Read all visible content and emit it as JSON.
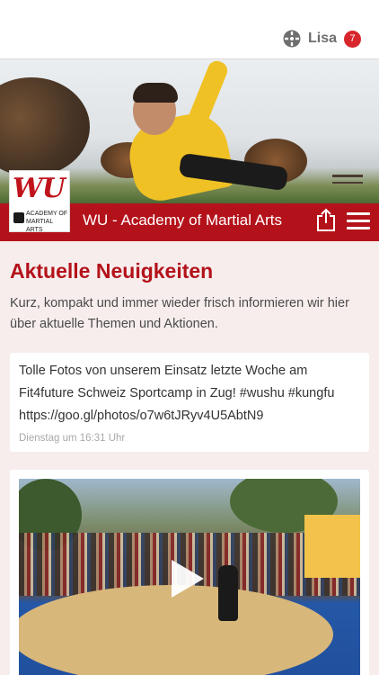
{
  "header": {
    "user_name": "Lisa",
    "notification_count": "7",
    "user_icon": "user-roles-icon"
  },
  "brand": {
    "logo_text": "WU",
    "logo_subtitle": "ACADEMY OF MARTIAL ARTS",
    "title": "WU - Academy of Martial Arts",
    "accent_color": "#b4121a",
    "share_icon": "share-icon",
    "menu_icon": "hamburger-menu-icon"
  },
  "section": {
    "title": "Aktuelle Neuigkeiten",
    "description": "Kurz, kompakt und immer wieder frisch informieren wir hier über aktuelle Themen und Aktionen."
  },
  "posts": [
    {
      "text": "Tolle Fotos von unserem Einsatz letzte Woche am Fit4future Schweiz Sportcamp in Zug! #wushu #kungfu https://goo.gl/photos/o7w6tJRyv4U5AbtN9",
      "time": "Dienstag um 16:31 Uhr"
    }
  ],
  "video": {
    "play_icon": "play-icon"
  }
}
